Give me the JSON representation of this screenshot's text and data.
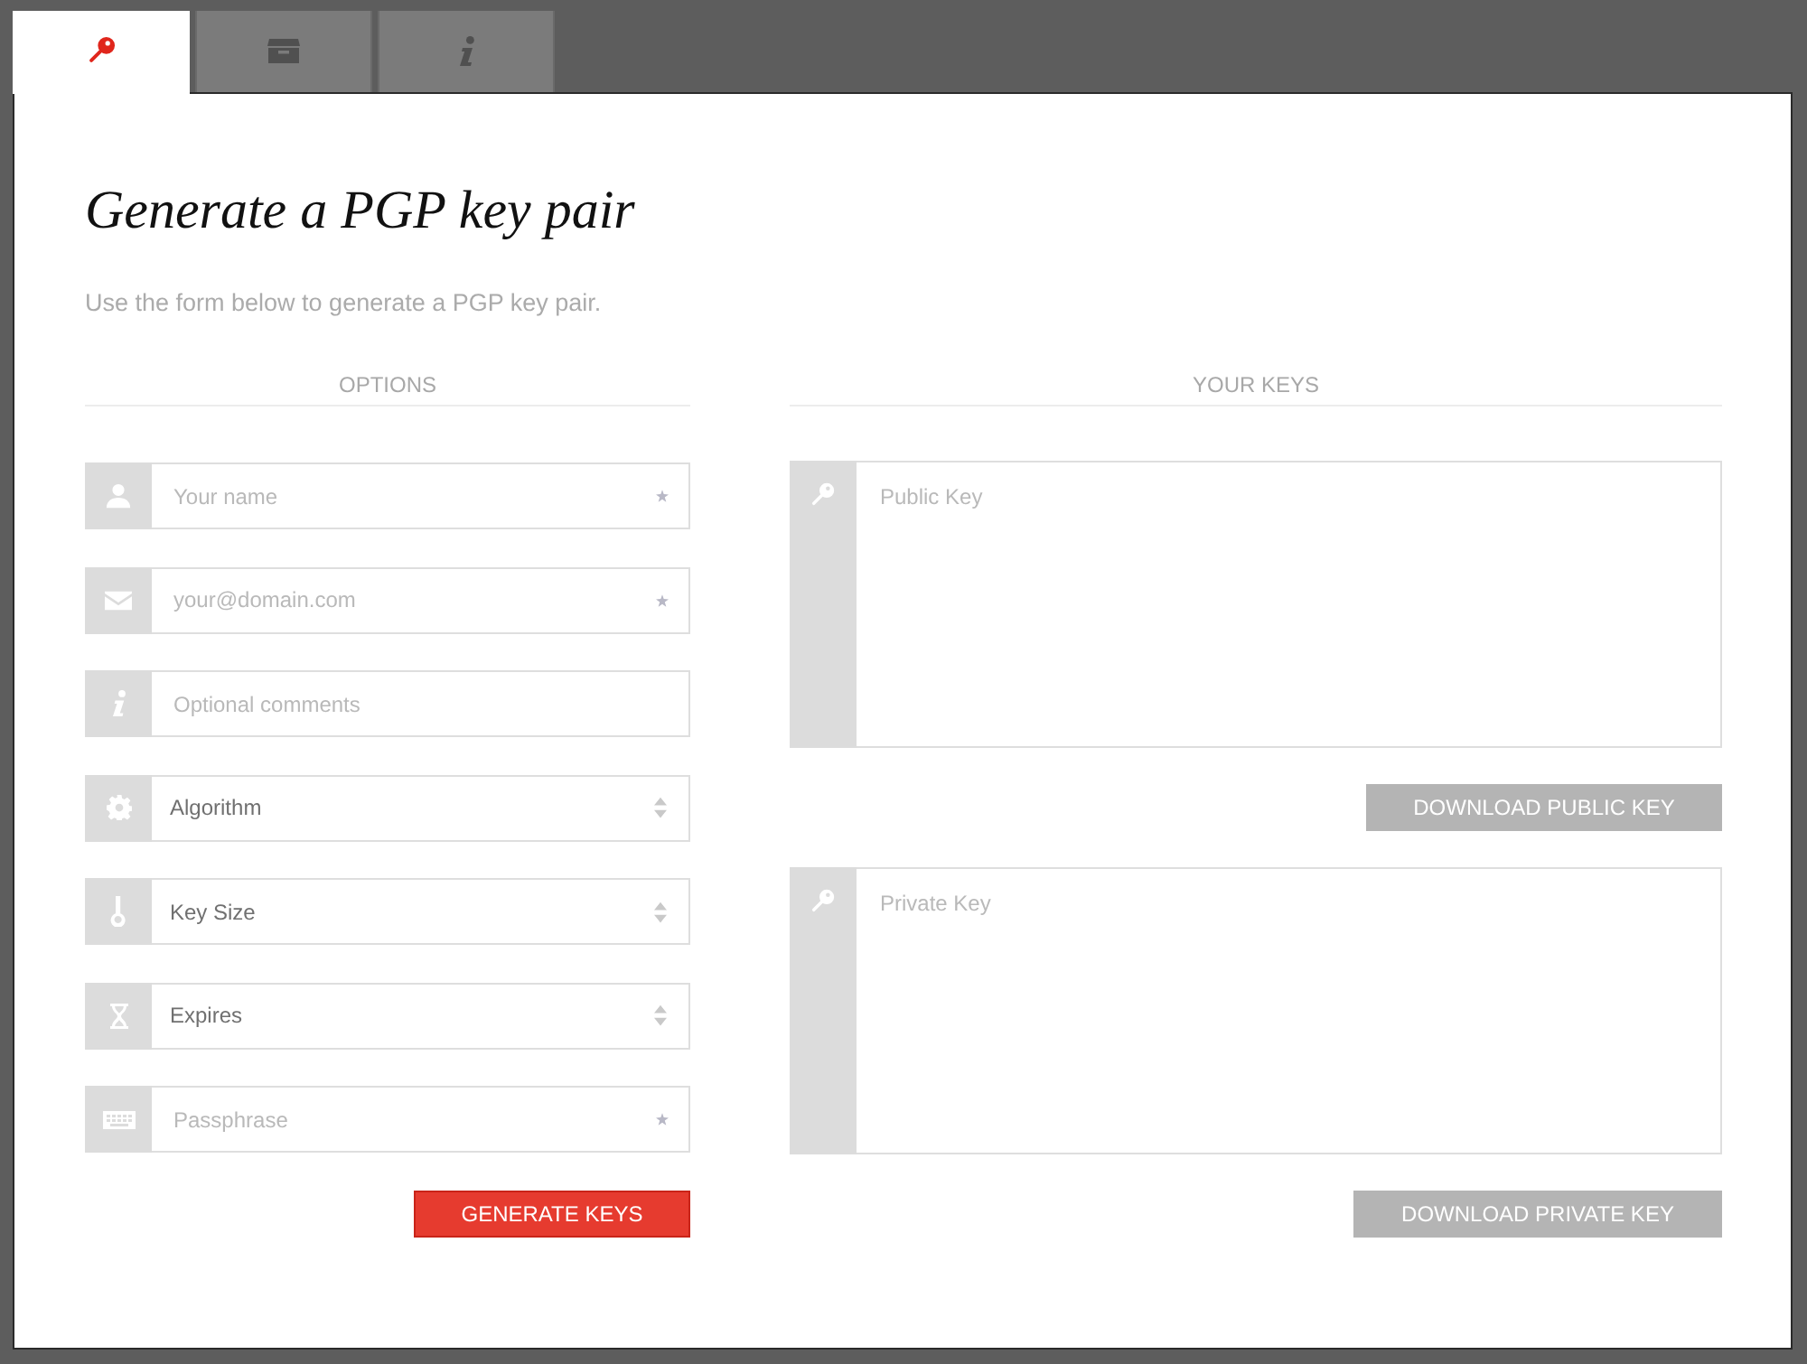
{
  "tabs": [
    {
      "selected": true
    },
    {
      "selected": false
    },
    {
      "selected": false
    }
  ],
  "heading": "Generate a PGP key pair",
  "intro": "Use the form below to generate a PGP key pair.",
  "options": {
    "title": "OPTIONS",
    "fields": [
      {
        "kind": "text",
        "placeholder": "Your name",
        "required": true
      },
      {
        "kind": "text",
        "placeholder": "your@domain.com",
        "required": true
      },
      {
        "kind": "text",
        "placeholder": "Optional comments",
        "required": false
      },
      {
        "kind": "select",
        "value": "Algorithm"
      },
      {
        "kind": "select",
        "value": "Key Size"
      },
      {
        "kind": "select",
        "value": "Expires"
      },
      {
        "kind": "password",
        "placeholder": "Passphrase",
        "required": true
      }
    ],
    "submit": {
      "label": "GENERATE KEYS",
      "disabled": false
    }
  },
  "keys": {
    "title": "YOUR KEYS",
    "boxes": [
      {
        "placeholder": "Public Key",
        "button": {
          "label": "DOWNLOAD PUBLIC KEY",
          "disabled": true
        }
      },
      {
        "placeholder": "Private Key",
        "button": {
          "label": "DOWNLOAD PRIVATE KEY",
          "disabled": true
        }
      }
    ]
  }
}
